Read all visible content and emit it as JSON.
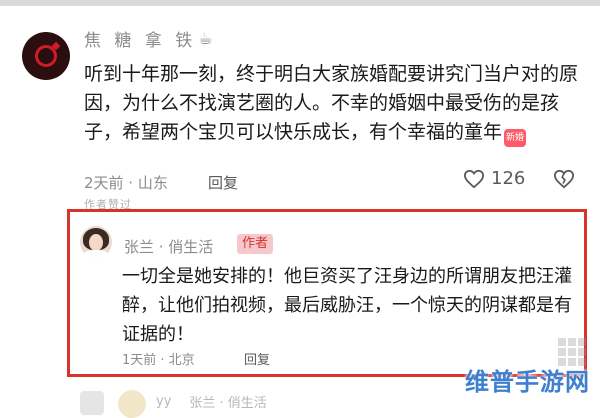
{
  "comment1": {
    "author": "焦 糖 拿 铁",
    "author_icon": "coffee-icon",
    "text": "听到十年那一刻，终于明白大家族婚配要讲究门当户对的原因，为什么不找演艺圈的人。不幸的婚姻中最受伤的是孩子，希望两个宝贝可以快乐成长，有个幸福的童年",
    "emoji": "新婚",
    "time_location": "2天前 · 山东",
    "reply_label": "回复",
    "likes": "126"
  },
  "faded_text": "作者赞过",
  "author_reply": {
    "author": "张兰 · 俏生活",
    "badge": "作者",
    "text": "一切全是她安排的！他巨资买了汪身边的所谓朋友把汪灌醉，让他们拍视频，最后威胁汪，一个惊天的阴谋都是有证据的！",
    "time_location": "1天前 · 北京",
    "reply_label": "回复"
  },
  "bottom_partial": {
    "name1": "yy",
    "name2": "张兰 · 俏生活"
  },
  "watermark": "维普手游网",
  "colors": {
    "highlight_border": "#d8322b",
    "badge_bg": "#f5c9cc",
    "watermark": "#3f7fcf"
  }
}
